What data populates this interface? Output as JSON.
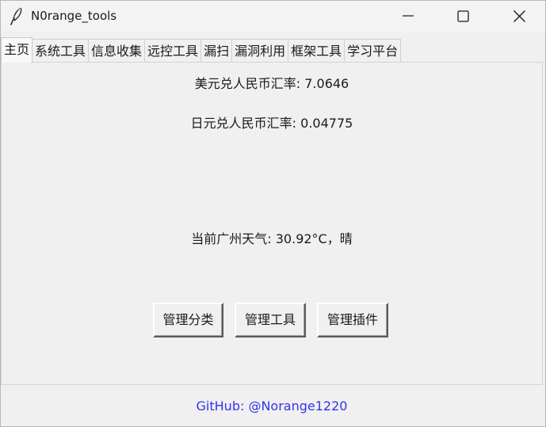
{
  "window": {
    "title": "N0range_tools"
  },
  "tabs": [
    {
      "label": "主页",
      "active": true
    },
    {
      "label": "系统工具",
      "active": false
    },
    {
      "label": "信息收集",
      "active": false
    },
    {
      "label": "远控工具",
      "active": false
    },
    {
      "label": "漏扫",
      "active": false
    },
    {
      "label": "漏洞利用",
      "active": false
    },
    {
      "label": "框架工具",
      "active": false
    },
    {
      "label": "学习平台",
      "active": false
    }
  ],
  "home": {
    "usd_rate": "美元兑人民币汇率: 7.0646",
    "jpy_rate": "日元兑人民币汇率: 0.04775",
    "weather": "当前广州天气: 30.92°C，晴",
    "buttons": {
      "manage_category": "管理分类",
      "manage_tools": "管理工具",
      "manage_plugins": "管理插件"
    }
  },
  "footer": {
    "github": "GitHub: @Norange1220"
  },
  "colors": {
    "link": "#3333ee",
    "background": "#f0f0f0"
  },
  "icons": {
    "app": "feather-icon",
    "minimize": "minimize-icon",
    "maximize": "maximize-icon",
    "close": "close-icon"
  }
}
